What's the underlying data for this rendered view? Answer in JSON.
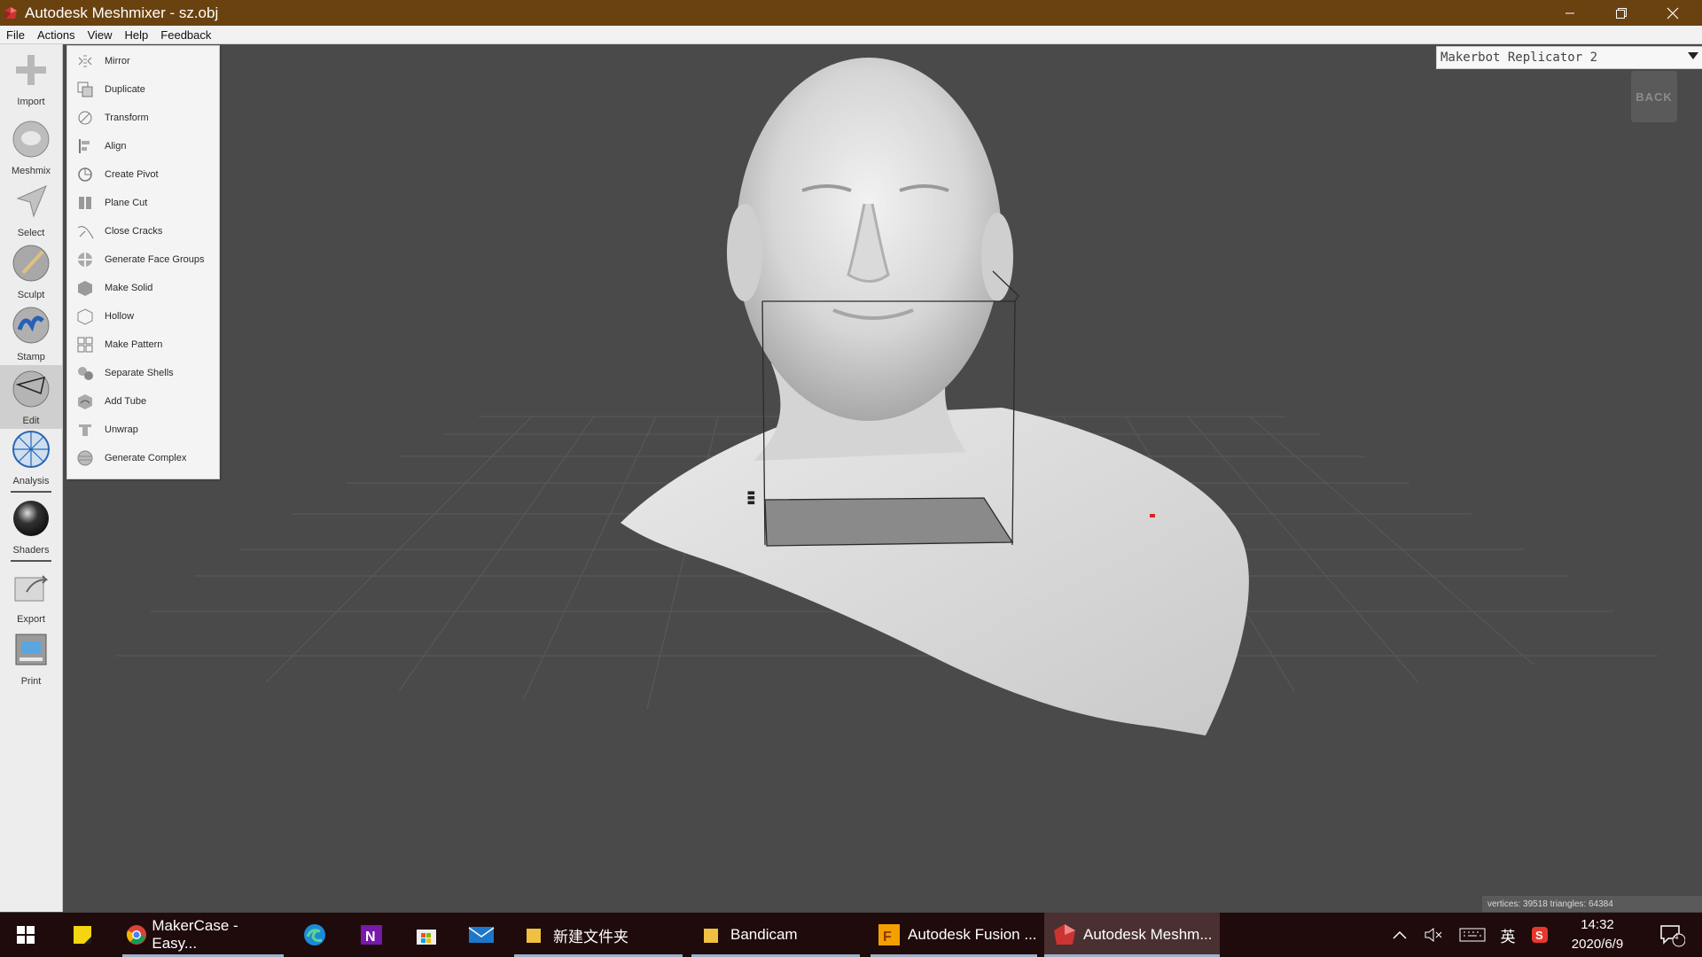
{
  "window": {
    "title": "Autodesk Meshmixer - sz.obj"
  },
  "menubar": {
    "items": [
      "File",
      "Actions",
      "View",
      "Help",
      "Feedback"
    ]
  },
  "toolbar": {
    "tools": [
      "Import",
      "Meshmix",
      "Select",
      "Sculpt",
      "Stamp",
      "Edit",
      "Analysis",
      "Shaders",
      "Export",
      "Print"
    ],
    "active": "Edit"
  },
  "edit_menu": {
    "items": [
      "Mirror",
      "Duplicate",
      "Transform",
      "Align",
      "Create Pivot",
      "Plane Cut",
      "Close Cracks",
      "Generate Face Groups",
      "Make Solid",
      "Hollow",
      "Make Pattern",
      "Separate Shells",
      "Add Tube",
      "Unwrap",
      "Generate Complex"
    ]
  },
  "viewport": {
    "printer": "Makerbot Replicator 2",
    "back_label": "BACK",
    "stats": "vertices: 39518 triangles: 64384"
  },
  "taskbar": {
    "apps": [
      "MakerCase - Easy...",
      "新建文件夹",
      "Bandicam",
      "Autodesk Fusion ...",
      "Autodesk Meshm..."
    ],
    "ime": "英",
    "time": "14:32",
    "date": "2020/6/9",
    "notifications": "4"
  }
}
